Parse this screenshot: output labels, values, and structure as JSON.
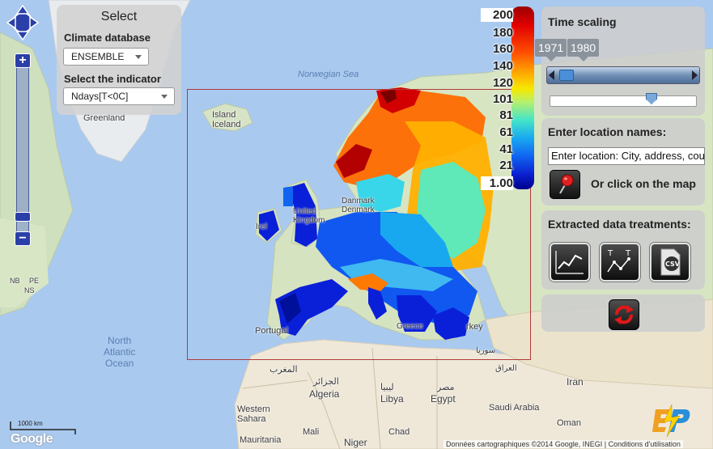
{
  "select_panel": {
    "title": "Select",
    "database_label": "Climate database",
    "database_value": "ENSEMBLE",
    "indicator_label": "Select the indicator",
    "indicator_value": "Ndays[T<0C]"
  },
  "legend": {
    "values": [
      "200",
      "180",
      "160",
      "140",
      "120",
      "101",
      "81",
      "61",
      "41",
      "21",
      "1.00"
    ]
  },
  "time_scaling": {
    "title": "Time scaling",
    "start_year": "1971",
    "end_year": "1980"
  },
  "location": {
    "title": "Enter location names:",
    "input_placeholder": "Enter location: City, address, cou",
    "click_map_text": "Or click on the map"
  },
  "treatments": {
    "title": "Extracted data treatments:",
    "tools": [
      "line-chart-icon",
      "scatter-chart-icon",
      "csv-icon"
    ]
  },
  "map": {
    "labels": {
      "norwegian_sea": "Norwegian Sea",
      "greenland": "Greenland",
      "iceland": "Island\nIceland",
      "united_kingdom": "United\nKingdom",
      "ireland": "Irel",
      "denmark": "Danmark\nDenmark",
      "portugal": "Portugal",
      "greece": "Greece",
      "turkey": "rkey",
      "north_atlantic": "North\nAtlantic\nOcean",
      "morocco": "المغرب",
      "algeria_ar": "الجزائر",
      "algeria": "Algeria",
      "libya_ar": "ليبيا",
      "libya": "Libya",
      "egypt_ar": "مصر",
      "egypt": "Egypt",
      "western_sahara": "Western\nSahara",
      "mauritania": "Mauritania",
      "mali": "Mali",
      "niger": "Niger",
      "chad": "Chad",
      "saudi_arabia": "Saudi Arabia",
      "oman": "Oman",
      "nb": "NB",
      "ns": "NS",
      "pe": "PE",
      "syria": "سوريا",
      "iraq": "العراق",
      "iran": "Iran"
    },
    "scale_label": "1000 km",
    "google_logo": "Google",
    "attribution": "Données cartographiques ©2014 Google, INEGI | Conditions d'utilisation"
  },
  "colors": {
    "frame": "#b23a3a",
    "legend_top": "#9b0000",
    "legend_bottom": "#00008a"
  }
}
